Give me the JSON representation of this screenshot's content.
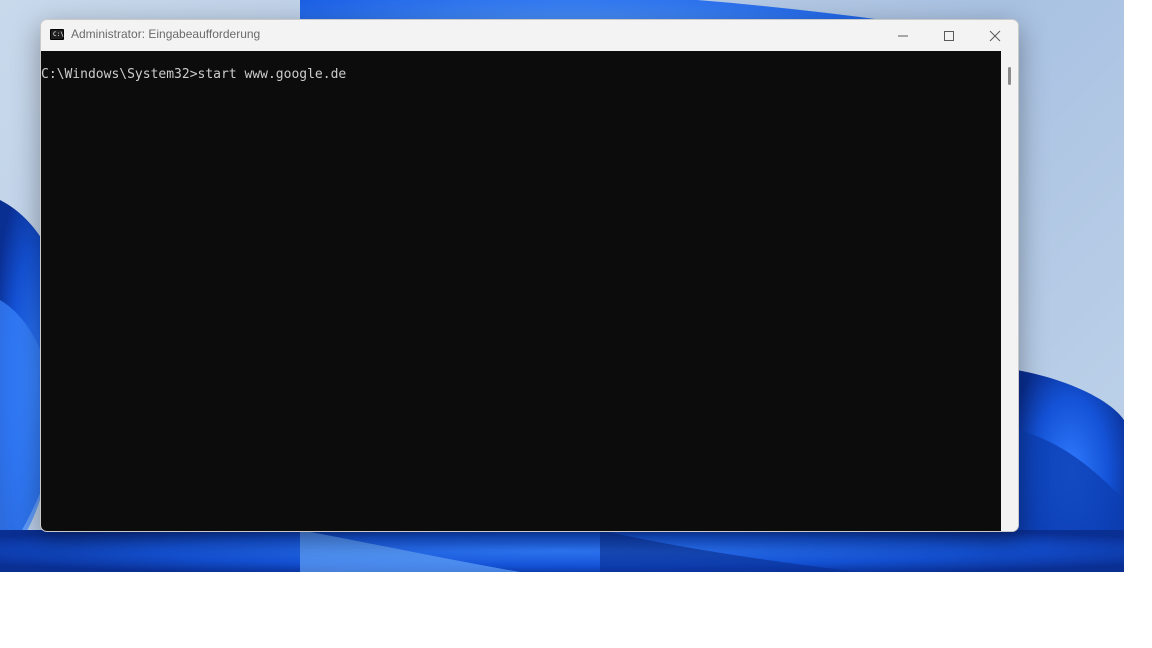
{
  "window": {
    "title": "Administrator: Eingabeaufforderung",
    "icon": "cmd-terminal-icon",
    "controls": {
      "minimize": "minimize-icon",
      "maximize": "maximize-icon",
      "close": "close-icon"
    }
  },
  "terminal": {
    "lines": [
      "C:\\Windows\\System32>start www.google.de"
    ],
    "background_color": "#0c0c0c",
    "text_color": "#cccccc"
  },
  "desktop": {
    "wallpaper": "windows-11-bloom",
    "accent_color": "#1a5be6"
  }
}
